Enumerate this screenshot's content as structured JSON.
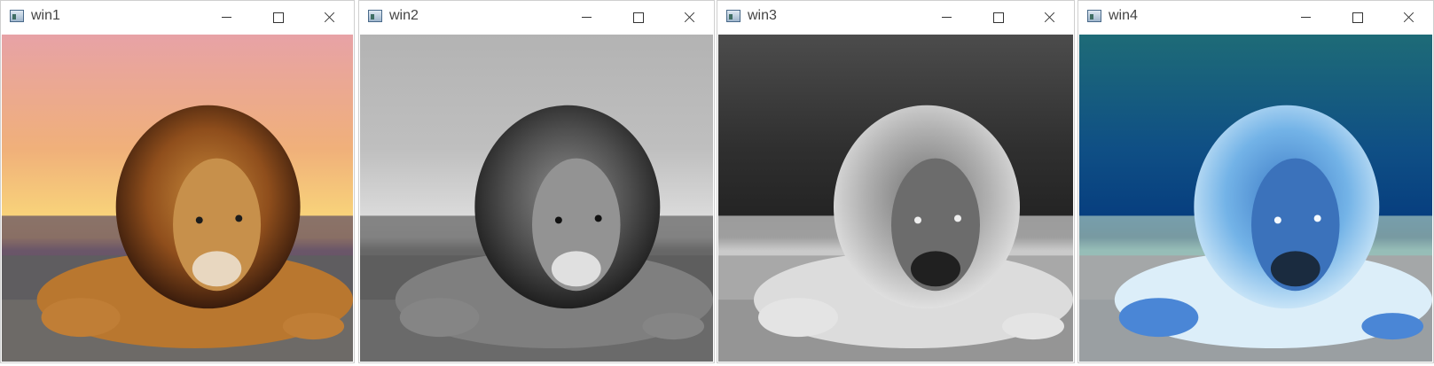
{
  "windows": [
    {
      "id": "w1",
      "title": "win1",
      "filter": "none"
    },
    {
      "id": "w2",
      "title": "win2",
      "filter": "grayscale"
    },
    {
      "id": "w3",
      "title": "win3",
      "filter": "inverted-grayscale"
    },
    {
      "id": "w4",
      "title": "win4",
      "filter": "inverted-color"
    }
  ],
  "icons": {
    "app": "opencv-window-icon",
    "minimize": "minimize-icon",
    "maximize": "maximize-icon",
    "close": "close-icon"
  },
  "image_subject": "lion lying on rocky beach at sunset"
}
